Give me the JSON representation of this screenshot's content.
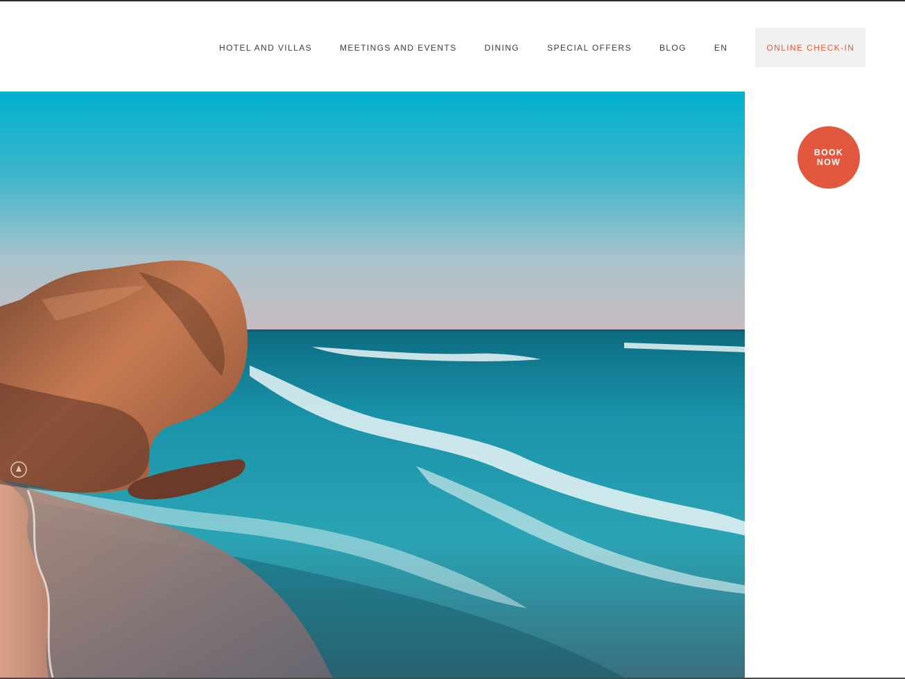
{
  "nav": {
    "items": [
      {
        "label": "HOTEL AND VILLAS"
      },
      {
        "label": "MEETINGS AND EVENTS"
      },
      {
        "label": "DINING"
      },
      {
        "label": "SPECIAL OFFERS"
      },
      {
        "label": "BLOG"
      },
      {
        "label": "EN"
      }
    ],
    "checkin_label": "ONLINE CHECK-IN"
  },
  "book": {
    "line1": "BOOK",
    "line2": "NOW"
  },
  "colors": {
    "accent": "#e2583e",
    "checkin_bg": "#f2f1ef",
    "nav_text": "#3a3a3a",
    "sky_top": "#00b2cf",
    "sea": "#1a8fa6"
  },
  "hero": {
    "image_icons": [
      "play-circle-icon"
    ]
  }
}
